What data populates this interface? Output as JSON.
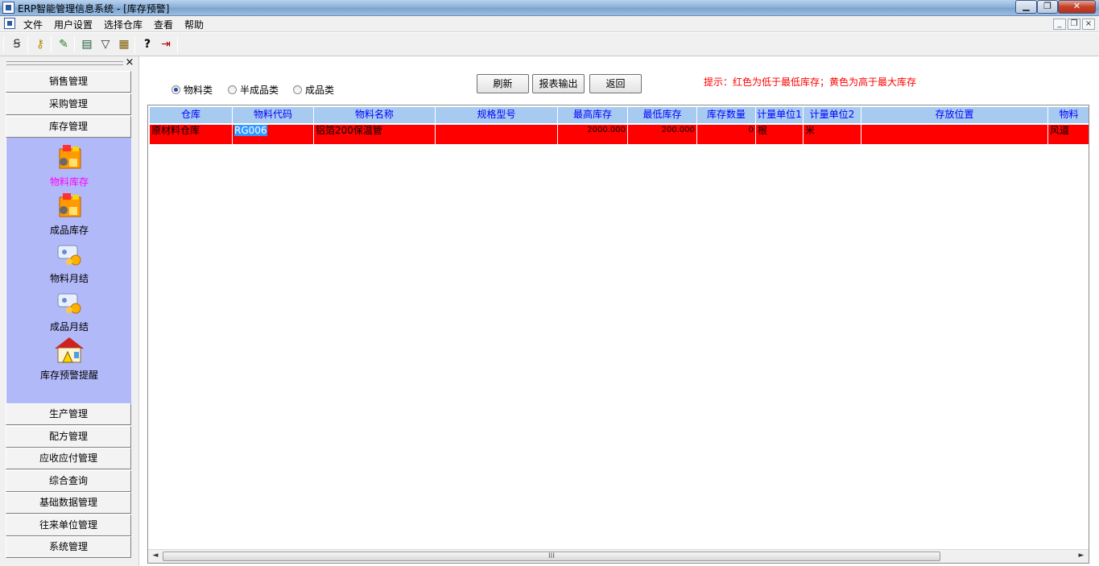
{
  "window": {
    "title": "ERP智能管理信息系统 - [库存预警]",
    "minimize_label": "▁",
    "maximize_label": "❐",
    "close_label": "✕"
  },
  "menu": {
    "items": [
      "文件",
      "用户设置",
      "选择仓库",
      "查看",
      "帮助"
    ],
    "mdi_minimize": "_",
    "mdi_restore": "❐",
    "mdi_close": "×"
  },
  "toolbar": {
    "icons": [
      "switch-icon",
      "key-icon",
      "pen-icon",
      "window-icon",
      "filter-icon",
      "calculator-icon",
      "help-icon",
      "exit-icon"
    ],
    "glyphs": [
      "Ꞩ",
      "⚷",
      "✎",
      "▤",
      "▽",
      "▦",
      "?",
      "⇥"
    ]
  },
  "sidebar": {
    "close_glyph": "×",
    "top_items": [
      "销售管理",
      "采购管理",
      "库存管理"
    ],
    "sub_items": [
      {
        "label": "物料库存",
        "icon": "material-stock-icon",
        "active": true
      },
      {
        "label": "成品库存",
        "icon": "product-stock-icon",
        "active": false
      },
      {
        "label": "物料月结",
        "icon": "material-monthly-icon",
        "active": false
      },
      {
        "label": "成品月结",
        "icon": "product-monthly-icon",
        "active": false
      },
      {
        "label": "库存预警提醒",
        "icon": "stock-alert-icon",
        "active": false
      }
    ],
    "bottom_items": [
      "生产管理",
      "配方管理",
      "应收应付管理",
      "综合查询",
      "基础数据管理",
      "往来单位管理",
      "系统管理"
    ]
  },
  "filters": {
    "options": [
      "物料类",
      "半成品类",
      "成品类"
    ],
    "selected": "物料类"
  },
  "actions": {
    "refresh": "刷新",
    "export": "报表输出",
    "back": "返回"
  },
  "hint": "提示：红色为低于最低库存；黄色为高于最大库存",
  "grid": {
    "columns": [
      "仓库",
      "物料代码",
      "物料名称",
      "规格型号",
      "最高库存",
      "最低库存",
      "库存数量",
      "计量单位1",
      "计量单位2",
      "存放位置",
      "物料"
    ],
    "rows": [
      {
        "status_color": "#ff0000",
        "cells": [
          "原材料仓库",
          "RG006",
          "铝箔200保温管",
          "",
          "2000.000",
          "200.000",
          "0",
          "根",
          "米",
          "",
          "风道"
        ]
      }
    ],
    "scroll_thumb_glyph": "III",
    "scroll_left": "◄",
    "scroll_right": "►"
  }
}
